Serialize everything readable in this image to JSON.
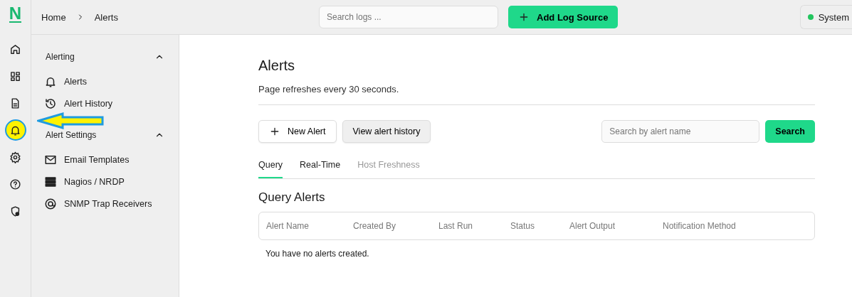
{
  "logo": "N",
  "rail": [
    {
      "kind": "home",
      "highlighted": false
    },
    {
      "kind": "dashboard",
      "highlighted": false
    },
    {
      "kind": "document",
      "highlighted": false
    },
    {
      "kind": "bell",
      "highlighted": true
    },
    {
      "kind": "gear",
      "highlighted": false
    },
    {
      "kind": "help",
      "highlighted": false
    },
    {
      "kind": "shield",
      "highlighted": false
    }
  ],
  "breadcrumb": [
    "Home",
    "Alerts"
  ],
  "top_search": {
    "placeholder": "Search logs ..."
  },
  "add_button": "Add Log Source",
  "system": {
    "label": "System",
    "color": "#22c55e"
  },
  "sidebar": [
    {
      "title": "Alerting",
      "expanded": true,
      "items": [
        {
          "kind": "bell",
          "label": "Alerts"
        },
        {
          "kind": "history",
          "label": "Alert History"
        }
      ]
    },
    {
      "title": "Alert Settings",
      "expanded": true,
      "items": [
        {
          "kind": "mail",
          "label": "Email Templates"
        },
        {
          "kind": "server",
          "label": "Nagios / NRDP"
        },
        {
          "kind": "target",
          "label": "SNMP Trap Receivers"
        }
      ]
    }
  ],
  "page": {
    "title": "Alerts",
    "subtitle": "Page refreshes every 30 seconds."
  },
  "actions": {
    "new": "New Alert",
    "history": "View alert history",
    "search_placeholder": "Search by alert name",
    "search": "Search"
  },
  "tabs": [
    {
      "label": "Query",
      "selected": true,
      "disabled": false
    },
    {
      "label": "Real-Time",
      "selected": false,
      "disabled": false
    },
    {
      "label": "Host Freshness",
      "selected": false,
      "disabled": true
    }
  ],
  "section_title": "Query Alerts",
  "table": {
    "columns": [
      "Alert Name",
      "Created By",
      "Last Run",
      "Status",
      "Alert Output",
      "Notification Method"
    ],
    "empty": "You have no alerts created."
  }
}
